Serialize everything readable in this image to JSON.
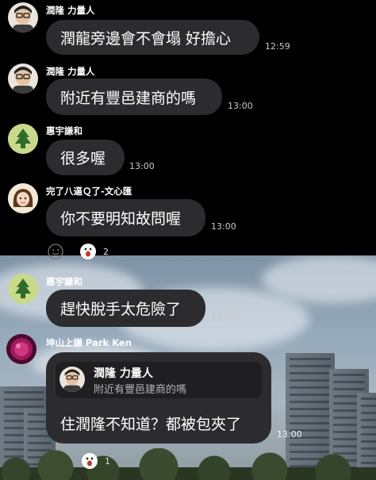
{
  "messages": [
    {
      "sender": "潤隆 力量人",
      "text": "潤龍旁邊會不會塌 好擔心",
      "time": "12:59"
    },
    {
      "sender": "潤隆 力量人",
      "text": "附近有豐邑建商的嗎",
      "time": "13:00"
    },
    {
      "sender": "惠宇謙和",
      "text": "很多喔",
      "time": "13:00"
    },
    {
      "sender": "完了八逼Ｑ了-文心匯",
      "text": "你不要明知故問喔",
      "time": "13:00"
    },
    {
      "sender": "惠宇謙和",
      "text": "趕快脫手太危險了",
      "time": "13:00"
    },
    {
      "sender": "坤山上謙 Park Ken",
      "quote": {
        "sender": "潤隆 力量人",
        "text": "附近有豐邑建商的嗎"
      },
      "text": "住潤隆不知道？都被包夾了",
      "time": "13:00"
    }
  ],
  "reactions": [
    {
      "count": "2"
    },
    {
      "count": "1"
    }
  ],
  "colors": {
    "bubble": "#2c2c2e",
    "background_top": "#000000"
  }
}
